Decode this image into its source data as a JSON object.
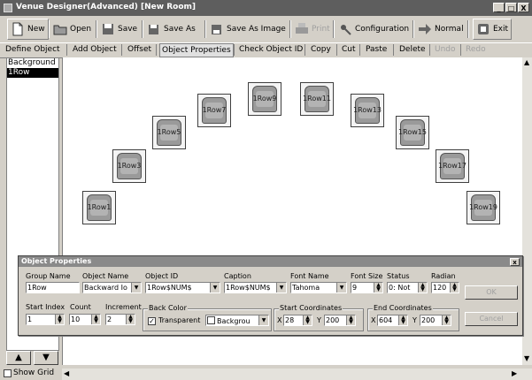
{
  "window": {
    "title": "Venue Designer(Advanced) [New Room]",
    "minimize": "_",
    "maximize": "□",
    "close": "X"
  },
  "toolbar": {
    "new_label": "New",
    "open_label": "Open",
    "save_label": "Save",
    "save_as_label": "Save As",
    "save_as_image_label": "Save As Image",
    "print_label": "Print",
    "configuration_label": "Configuration",
    "normal_label": "Normal",
    "exit_label": "Exit"
  },
  "menu": {
    "define_object": "Define Object",
    "add_object": "Add Object",
    "offset": "Offset",
    "object_properties": "Object Properties",
    "check_object_id": "Check Object ID",
    "copy": "Copy",
    "cut": "Cut",
    "paste": "Paste",
    "delete": "Delete",
    "undo": "Undo",
    "redo": "Redo"
  },
  "object_list": [
    "Background",
    "1Row"
  ],
  "seats": [
    {
      "label": "1Row1"
    },
    {
      "label": "1Row3"
    },
    {
      "label": "1Row5"
    },
    {
      "label": "1Row7"
    },
    {
      "label": "1Row9"
    },
    {
      "label": "1Row11"
    },
    {
      "label": "1Row13"
    },
    {
      "label": "1Row15"
    },
    {
      "label": "1Row17"
    },
    {
      "label": "1Row19"
    }
  ],
  "nav": {
    "up": "▲",
    "down": "▼"
  },
  "show_grid_label": "Show Grid",
  "properties": {
    "title": "Object Properties",
    "close": "x",
    "group_name_label": "Group Name",
    "group_name_value": "1Row",
    "object_name_label": "Object Name",
    "object_name_value": "Backward Io",
    "object_id_label": "Object ID",
    "object_id_value": "1Row$NUM$",
    "caption_label": "Caption",
    "caption_value": "1Row$NUM$",
    "font_name_label": "Font Name",
    "font_name_value": "Tahoma",
    "font_size_label": "Font Size",
    "font_size_value": "9",
    "status_label": "Status",
    "status_value": "0: Not",
    "radian_label": "Radian",
    "radian_value": "120",
    "ok_label": "OK",
    "start_index_label": "Start Index",
    "start_index_value": "1",
    "count_label": "Count",
    "count_value": "10",
    "increment_label": "Increment",
    "increment_value": "2",
    "back_color_label": "Back Color",
    "transparent_label": "Transparent",
    "background_label": "Backgrou",
    "start_coords_label": "Start Coordinates",
    "start_x_label": "X",
    "start_x_value": "28",
    "start_y_label": "Y",
    "start_y_value": "200",
    "end_coords_label": "End Coordinates",
    "end_x_label": "X",
    "end_x_value": "604",
    "end_y_label": "Y",
    "end_y_value": "200",
    "cancel_label": "Cancel"
  }
}
